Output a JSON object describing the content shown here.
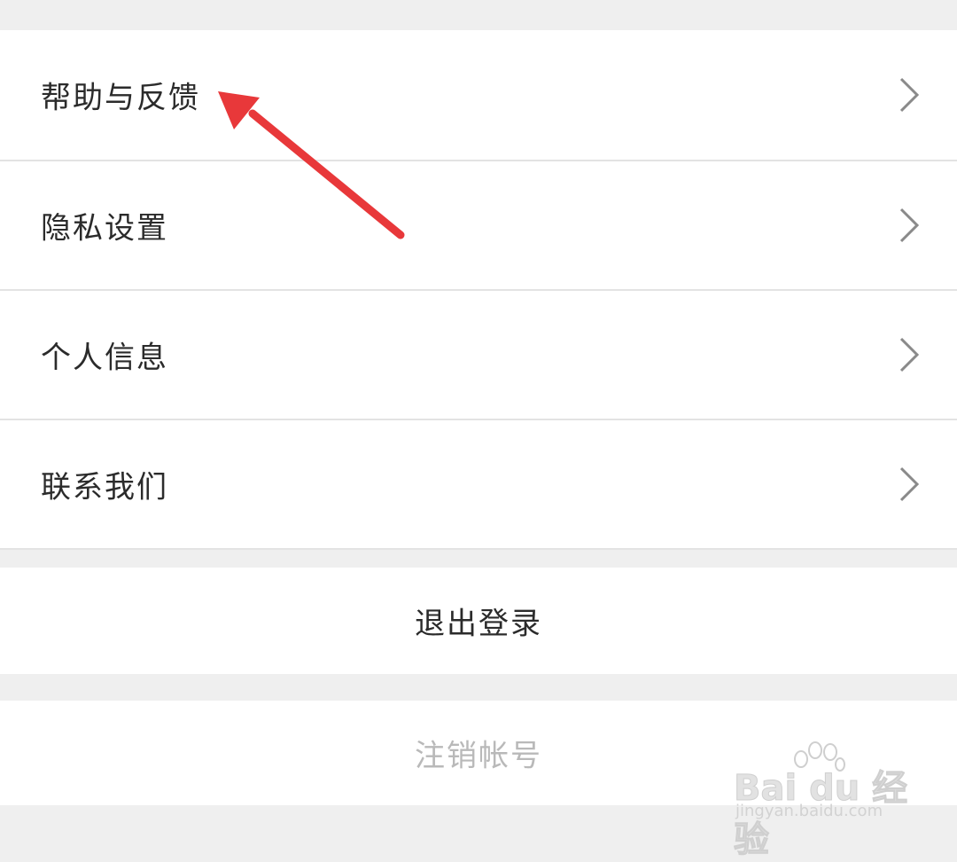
{
  "settings_list": {
    "items": [
      {
        "label": "帮助与反馈"
      },
      {
        "label": "隐私设置"
      },
      {
        "label": "个人信息"
      },
      {
        "label": "联系我们"
      }
    ]
  },
  "logout_button": {
    "label": "退出登录"
  },
  "cancel_account_button": {
    "label": "注销帐号"
  },
  "watermark": {
    "logo_text": "Bai du 经验",
    "url_text": "jingyan.baidu.com"
  },
  "colors": {
    "background": "#efefef",
    "row": "#ffffff",
    "text": "#2b2b2b",
    "disabled_text": "#b9b9b9",
    "chevron": "#8a8a8a",
    "annotation_arrow": "#e8383a"
  },
  "icons": {
    "row_chevron": "chevron-right-icon"
  }
}
